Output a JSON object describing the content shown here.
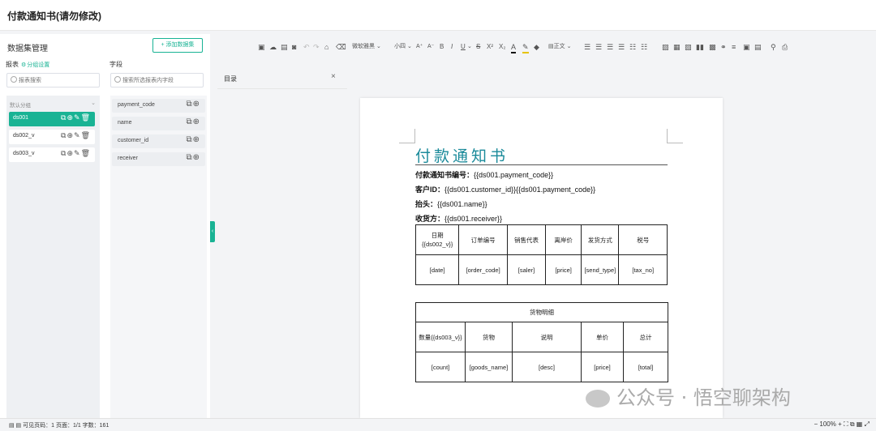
{
  "window": {
    "title": "付款通知书(请勿修改)"
  },
  "dataset_panel": {
    "title": "数据集管理",
    "add_button": "+ 添加数据集",
    "report_label": "报表",
    "group_settings": "分组设置",
    "field_label": "字段",
    "report_search_placeholder": "报表搜索",
    "field_search_placeholder": "搜索所选报表内字段",
    "group_name": "默认分组",
    "datasets": [
      {
        "name": "ds001",
        "active": true
      },
      {
        "name": "ds002_v",
        "active": false
      },
      {
        "name": "ds003_v",
        "active": false
      }
    ],
    "fields": [
      "payment_code",
      "name",
      "customer_id",
      "receiver"
    ]
  },
  "toolbar": {
    "font_name": "微软雅黑",
    "font_size": "小四",
    "paragraph": "正文",
    "items": [
      "A⁺",
      "A⁻",
      "B",
      "I",
      "U",
      "S",
      "X²",
      "X₂",
      "A"
    ]
  },
  "toc": {
    "label": "目录"
  },
  "document": {
    "title": "付款通知书",
    "lines": [
      {
        "label": "付款通知书编号：",
        "value": "{{ds001.payment_code}}"
      },
      {
        "label": "客户ID：",
        "value": "{{ds001.customer_id}}{{ds001.payment_code}}"
      },
      {
        "label": "抬头：",
        "value": "{{ds001.name}}"
      },
      {
        "label": "收货方：",
        "value": "{{ds001.receiver}}"
      }
    ],
    "table1": {
      "headers": [
        "日期{{ds002_v}}",
        "订单编号",
        "销售代表",
        "离岸价",
        "发货方式",
        "税号"
      ],
      "row": [
        "[date]",
        "[order_code]",
        "[saler]",
        "[price]",
        "[send_type]",
        "[tax_no]"
      ]
    },
    "table2": {
      "caption": "货物明细",
      "headers": [
        "数量{{ds003_v}}",
        "货物",
        "说明",
        "单价",
        "总计"
      ],
      "row": [
        "[count]",
        "[goods_name]",
        "[desc]",
        "[price]",
        "[total]"
      ]
    }
  },
  "watermark": {
    "text": "公众号 · 悟空聊架构"
  },
  "status": {
    "text": "可见页码：1  页面：1/1  字数：161",
    "zoom": "100%"
  },
  "colors": {
    "accent": "#19b394",
    "title": "#1a8a9a"
  }
}
